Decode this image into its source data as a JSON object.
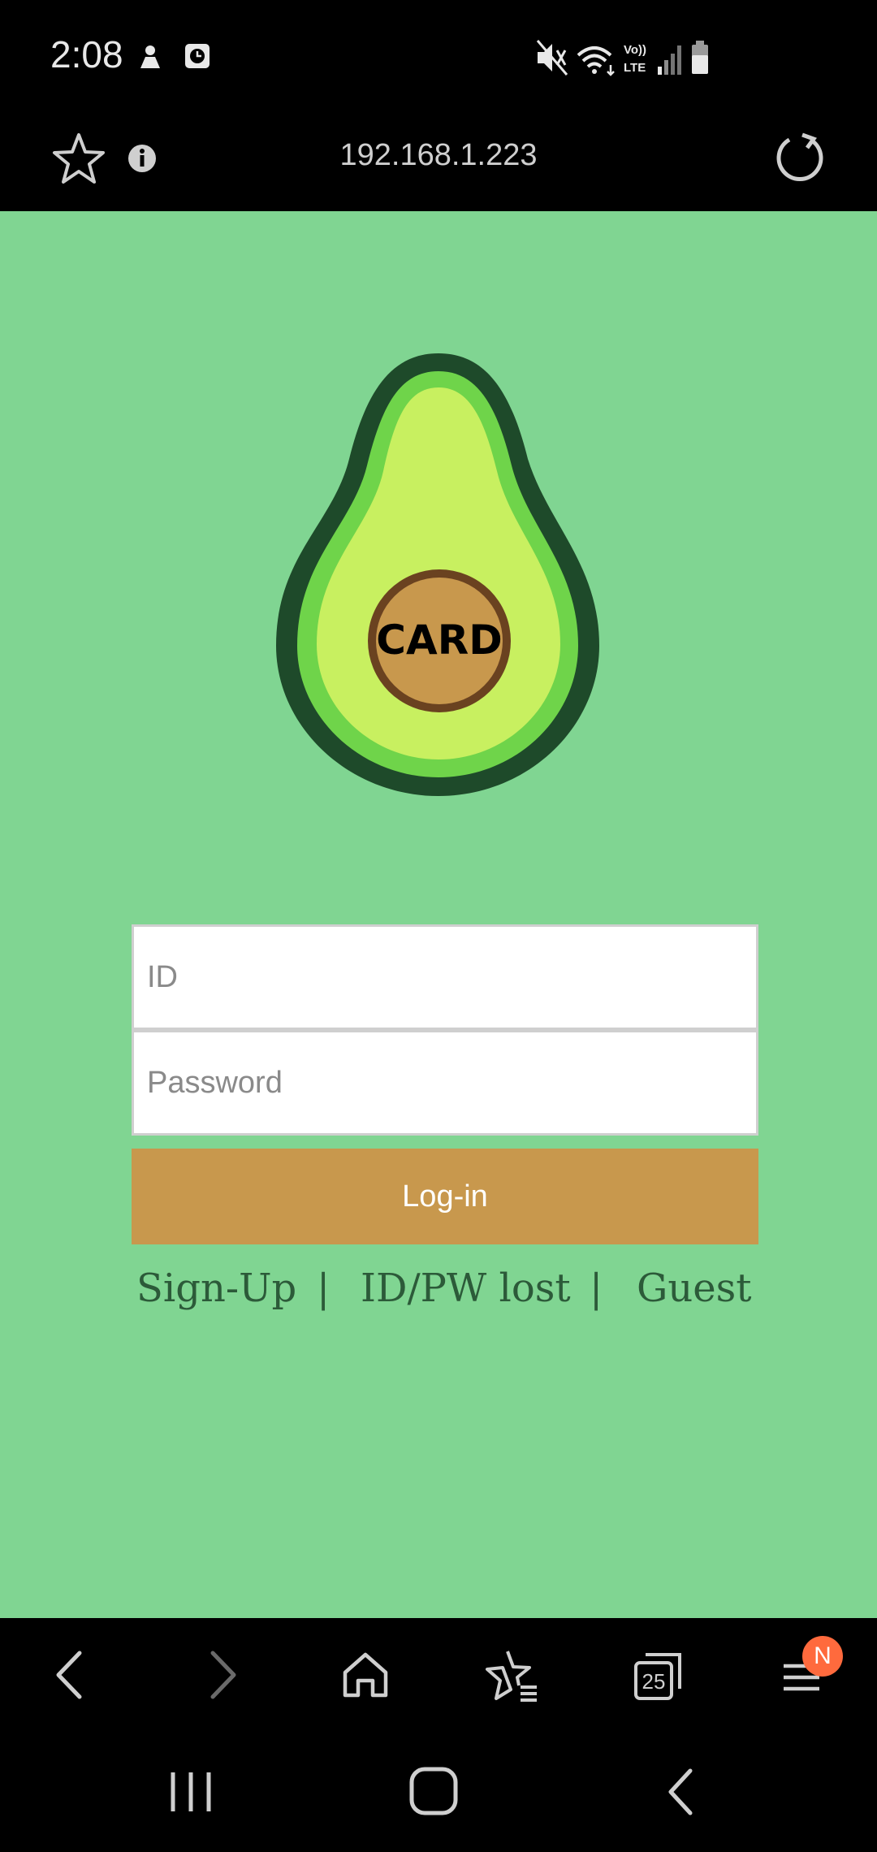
{
  "status_bar": {
    "time": "2:08",
    "left_icons": [
      "notification-icon",
      "clock-app-icon"
    ],
    "right_icons": [
      "mute-icon",
      "wifi-icon",
      "volte-icon",
      "signal-icon",
      "battery-icon"
    ],
    "volte_label_top": "Vo))",
    "volte_label_bottom": "LTE"
  },
  "browser": {
    "url": "192.168.1.223",
    "tab_count": "25",
    "menu_badge": "N"
  },
  "logo": {
    "text": "CARD",
    "colors": {
      "outer": "#1e4a2a",
      "rim": "#6fd44a",
      "flesh": "#c8f060",
      "pit": "#c8984d",
      "pit_rim": "#6a4220"
    }
  },
  "login": {
    "id_placeholder": "ID",
    "password_placeholder": "Password",
    "login_button": "Log-in"
  },
  "links": {
    "signup": "Sign-Up",
    "separator1": "|",
    "lost": "ID/PW lost",
    "separator2": "|",
    "guest": "Guest"
  },
  "colors": {
    "page_bg": "#80d592",
    "button": "#c8984d",
    "link_text": "#2c5a39"
  }
}
